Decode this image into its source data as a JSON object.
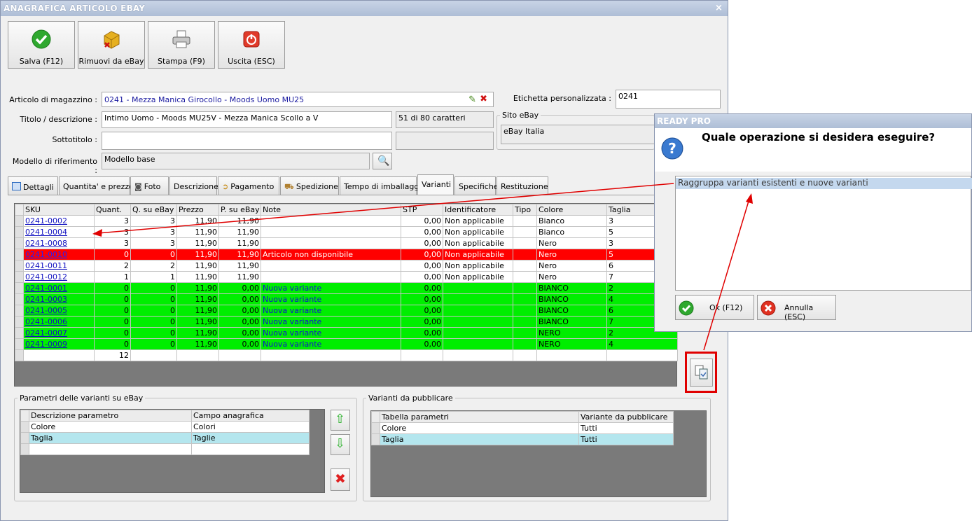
{
  "main_window": {
    "title": "ANAGRAFICA ARTICOLO EBAY",
    "close_glyph": "×",
    "toolbar": [
      {
        "label": "Salva (F12)",
        "icon": "check-icon"
      },
      {
        "label": "Rimuovi da eBay",
        "icon": "remove-box-icon"
      },
      {
        "label": "Stampa (F9)",
        "icon": "printer-icon"
      },
      {
        "label": "Uscita (ESC)",
        "icon": "exit-icon"
      }
    ],
    "form": {
      "articolo_label": "Articolo di magazzino :",
      "articolo_value": "0241 - Mezza Manica Girocollo - Moods Uomo MU25",
      "etichetta_label": "Etichetta personalizzata :",
      "etichetta_value": "0241",
      "titolo_label": "Titolo / descrizione :",
      "titolo_value": "Intimo Uomo - Moods MU25V - Mezza Manica Scollo a V",
      "char_count": "51 di 80 caratteri",
      "sottotitolo_label": "Sottotitolo :",
      "sottotitolo_value": "",
      "modello_label": "Modello di riferimento :",
      "modello_value": "Modello base",
      "sito_label": "Sito eBay",
      "sito_value": "eBay Italia"
    },
    "tabs": [
      "Dettagli",
      "Quantita' e prezzo",
      "Foto",
      "Descrizione",
      "Pagamento",
      "Spedizione",
      "Tempo di imballaggio",
      "Varianti",
      "Specifiche",
      "Restituzione"
    ],
    "active_tab": "Varianti",
    "grid": {
      "columns": [
        "SKU",
        "Quant.",
        "Q. su eBay",
        "Prezzo",
        "P. su eBay",
        "Note",
        "STP",
        "Identificatore",
        "Tipo",
        "Colore",
        "Taglia"
      ],
      "rows": [
        {
          "sku": "0241-0002",
          "quant": "3",
          "qebay": "3",
          "prezzo": "11,90",
          "pebay": "11,90",
          "note": "",
          "stp": "0,00",
          "ident": "Non applicabile",
          "tipo": "",
          "colore": "Bianco",
          "taglia": "3",
          "state": "w"
        },
        {
          "sku": "0241-0004",
          "quant": "3",
          "qebay": "3",
          "prezzo": "11,90",
          "pebay": "11,90",
          "note": "",
          "stp": "0,00",
          "ident": "Non applicabile",
          "tipo": "",
          "colore": "Bianco",
          "taglia": "5",
          "state": "w"
        },
        {
          "sku": "0241-0008",
          "quant": "3",
          "qebay": "3",
          "prezzo": "11,90",
          "pebay": "11,90",
          "note": "",
          "stp": "0,00",
          "ident": "Non applicabile",
          "tipo": "",
          "colore": "Nero",
          "taglia": "3",
          "state": "w"
        },
        {
          "sku": "0241-0010",
          "quant": "0",
          "qebay": "0",
          "prezzo": "11,90",
          "pebay": "11,90",
          "note": "Articolo non disponibile",
          "stp": "0,00",
          "ident": "Non applicabile",
          "tipo": "",
          "colore": "Nero",
          "taglia": "5",
          "state": "r"
        },
        {
          "sku": "0241-0011",
          "quant": "2",
          "qebay": "2",
          "prezzo": "11,90",
          "pebay": "11,90",
          "note": "",
          "stp": "0,00",
          "ident": "Non applicabile",
          "tipo": "",
          "colore": "Nero",
          "taglia": "6",
          "state": "w"
        },
        {
          "sku": "0241-0012",
          "quant": "1",
          "qebay": "1",
          "prezzo": "11,90",
          "pebay": "11,90",
          "note": "",
          "stp": "0,00",
          "ident": "Non applicabile",
          "tipo": "",
          "colore": "Nero",
          "taglia": "7",
          "state": "w"
        },
        {
          "sku": "0241-0001",
          "quant": "0",
          "qebay": "0",
          "prezzo": "11,90",
          "pebay": "0,00",
          "note": "Nuova variante",
          "stp": "0,00",
          "ident": "",
          "tipo": "",
          "colore": "BIANCO",
          "taglia": "2",
          "state": "g"
        },
        {
          "sku": "0241-0003",
          "quant": "0",
          "qebay": "0",
          "prezzo": "11,90",
          "pebay": "0,00",
          "note": "Nuova variante",
          "stp": "0,00",
          "ident": "",
          "tipo": "",
          "colore": "BIANCO",
          "taglia": "4",
          "state": "g"
        },
        {
          "sku": "0241-0005",
          "quant": "0",
          "qebay": "0",
          "prezzo": "11,90",
          "pebay": "0,00",
          "note": "Nuova variante",
          "stp": "0,00",
          "ident": "",
          "tipo": "",
          "colore": "BIANCO",
          "taglia": "6",
          "state": "g"
        },
        {
          "sku": "0241-0006",
          "quant": "0",
          "qebay": "0",
          "prezzo": "11,90",
          "pebay": "0,00",
          "note": "Nuova variante",
          "stp": "0,00",
          "ident": "",
          "tipo": "",
          "colore": "BIANCO",
          "taglia": "7",
          "state": "g"
        },
        {
          "sku": "0241-0007",
          "quant": "0",
          "qebay": "0",
          "prezzo": "11,90",
          "pebay": "0,00",
          "note": "Nuova variante",
          "stp": "0,00",
          "ident": "",
          "tipo": "",
          "colore": "NERO",
          "taglia": "2",
          "state": "g"
        },
        {
          "sku": "0241-0009",
          "quant": "0",
          "qebay": "0",
          "prezzo": "11,90",
          "pebay": "0,00",
          "note": "Nuova variante",
          "stp": "0,00",
          "ident": "",
          "tipo": "",
          "colore": "NERO",
          "taglia": "4",
          "state": "g"
        }
      ],
      "total_quant": "12"
    },
    "parametri": {
      "title": "Parametri delle varianti su eBay",
      "columns": [
        "Descrizione parametro",
        "Campo anagrafica"
      ],
      "rows": [
        [
          "Colore",
          "Colori"
        ],
        [
          "Taglia",
          "Taglie"
        ]
      ]
    },
    "varianti_pub": {
      "title": "Varianti da pubblicare",
      "columns": [
        "Tabella parametri",
        "Variante da pubblicare"
      ],
      "rows": [
        [
          "Colore",
          "Tutti"
        ],
        [
          "Taglia",
          "Tutti"
        ]
      ]
    }
  },
  "dialog": {
    "title": "READY PRO",
    "question": "Quale operazione si desidera eseguire?",
    "option": "Raggruppa varianti esistenti e nuove varianti",
    "ok_label": "Ok (F12)",
    "cancel_label": "Annulla (ESC)"
  },
  "colors": {
    "row_unavailable": "#ff0000",
    "row_new": "#00ee00",
    "annotation": "#e00000",
    "title_bar": "#aebed6"
  }
}
